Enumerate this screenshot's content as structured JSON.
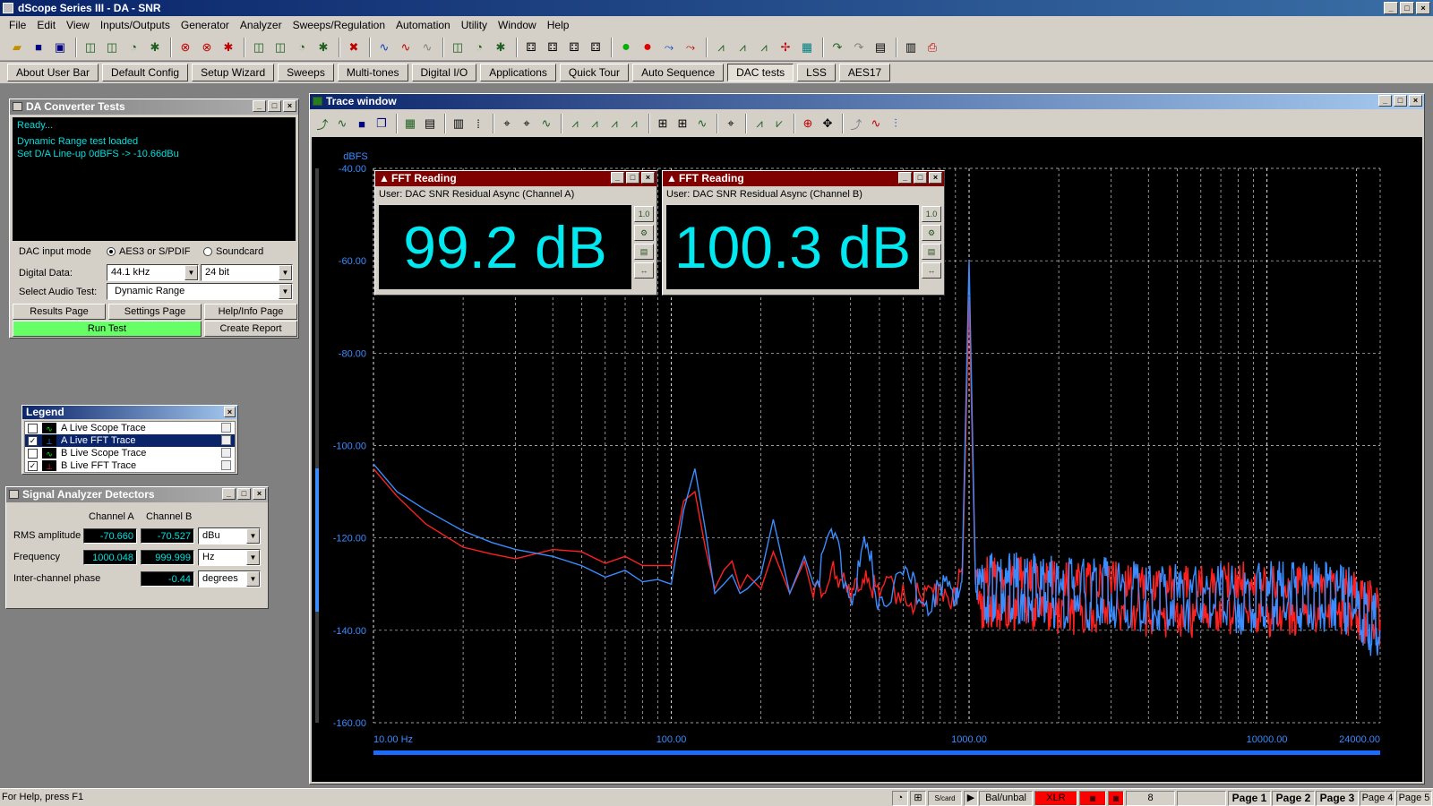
{
  "app": {
    "title": "dScope Series III - DA - SNR"
  },
  "menu": [
    "File",
    "Edit",
    "View",
    "Inputs/Outputs",
    "Generator",
    "Analyzer",
    "Sweeps/Regulation",
    "Automation",
    "Utility",
    "Window",
    "Help"
  ],
  "userbar": [
    "About User Bar",
    "Default Config",
    "Setup Wizard",
    "Sweeps",
    "Multi-tones",
    "Digital I/O",
    "Applications",
    "Quick Tour",
    "Auto Sequence",
    "DAC tests",
    "LSS",
    "AES17"
  ],
  "userbar_active": "DAC tests",
  "da_panel": {
    "title": "DA Converter Tests",
    "console": [
      "Ready...",
      "Dynamic Range test loaded",
      "Set D/A Line-up 0dBFS -> -10.66dBu"
    ],
    "dac_input_mode_label": "DAC input mode",
    "mode_opt1": "AES3 or S/PDIF",
    "mode_opt2": "Soundcard",
    "digital_data_label": "Digital Data:",
    "sample_rate": "44.1 kHz",
    "bit_depth": "24 bit",
    "select_test_label": "Select Audio Test:",
    "selected_test": "Dynamic Range",
    "results_btn": "Results Page",
    "settings_btn": "Settings Page",
    "help_btn": "Help/Info Page",
    "run_btn": "Run Test",
    "report_btn": "Create Report"
  },
  "legend": {
    "title": "Legend",
    "items": [
      {
        "label": "A  Live Scope Trace",
        "checked": false
      },
      {
        "label": "A  Live FFT Trace",
        "checked": true
      },
      {
        "label": "B  Live Scope Trace",
        "checked": false
      },
      {
        "label": "B  Live FFT Trace",
        "checked": true
      }
    ]
  },
  "detectors": {
    "title": "Signal Analyzer Detectors",
    "chA": "Channel A",
    "chB": "Channel B",
    "rms_label": "RMS amplitude",
    "rms_a": "-70.660",
    "rms_b": "-70.527",
    "rms_unit": "dBu",
    "freq_label": "Frequency",
    "freq_a": "1000.048",
    "freq_b": "999.999",
    "freq_unit": "Hz",
    "phase_label": "Inter-channel phase",
    "phase": "-0.44",
    "phase_unit": "degrees"
  },
  "trace_window": {
    "title": "Trace window"
  },
  "fft_a": {
    "title": "FFT Reading",
    "sub": "User: DAC SNR Residual Async (Channel A)",
    "value": "99.2 dB"
  },
  "fft_b": {
    "title": "FFT Reading",
    "sub": "User: DAC SNR Residual Async (Channel B)",
    "value": "100.3 dB"
  },
  "chart_data": {
    "type": "line",
    "ylabel": "dBFS",
    "ylim": [
      -160,
      -40
    ],
    "yticks": [
      "-40.00",
      "-60.00",
      "-80.00",
      "-100.00",
      "-120.00",
      "-140.00",
      "-160.00"
    ],
    "xlim": [
      10,
      24000
    ],
    "xscale": "log",
    "xticks": [
      {
        "v": 10,
        "t": "10.00 Hz"
      },
      {
        "v": 100,
        "t": "100.00"
      },
      {
        "v": 1000,
        "t": "1000.00"
      },
      {
        "v": 10000,
        "t": "10000.00"
      },
      {
        "v": 24000,
        "t": "24000.00"
      }
    ],
    "grid": true,
    "colors": {
      "A": "#3a8cff",
      "B": "#ff2020"
    },
    "series": [
      {
        "channel": "B",
        "x": [
          10,
          12,
          15,
          20,
          25,
          30,
          40,
          50,
          60,
          70,
          80,
          90,
          100,
          110,
          120,
          130,
          140,
          150,
          160,
          170,
          180,
          200,
          220,
          250,
          280,
          300,
          350,
          400,
          450,
          500,
          600,
          700,
          800,
          900,
          950,
          1000,
          1050,
          1100,
          1500,
          2000,
          3000,
          5000,
          8000,
          12000,
          18000,
          24000
        ],
        "y": [
          -105,
          -111,
          -117,
          -122,
          -123.5,
          -124.5,
          -122.5,
          -123,
          -125.5,
          -124,
          -126,
          -126,
          -126,
          -112,
          -110,
          -122,
          -131,
          -127,
          -125,
          -131,
          -128,
          -131,
          -123,
          -132,
          -125,
          -133,
          -125,
          -134,
          -127,
          -133,
          -130,
          -135,
          -130,
          -133,
          -128,
          -68,
          -130,
          -132,
          -132,
          -133,
          -133,
          -134,
          -133,
          -134,
          -133,
          -138
        ]
      },
      {
        "channel": "A",
        "x": [
          10,
          12,
          15,
          20,
          25,
          30,
          40,
          50,
          60,
          70,
          80,
          90,
          100,
          110,
          120,
          130,
          140,
          150,
          160,
          170,
          180,
          200,
          220,
          250,
          280,
          300,
          350,
          400,
          450,
          500,
          600,
          700,
          800,
          900,
          950,
          1000,
          1050,
          1100,
          1500,
          2000,
          3000,
          5000,
          8000,
          12000,
          18000,
          24000
        ],
        "y": [
          -104,
          -110,
          -114,
          -118.5,
          -121,
          -122.5,
          -124,
          -126,
          -128.5,
          -127,
          -129.5,
          -129,
          -130,
          -114,
          -105,
          -118,
          -132,
          -130,
          -128,
          -132,
          -131,
          -128,
          -116,
          -132,
          -124,
          -130,
          -120,
          -133,
          -122,
          -133,
          -128,
          -134,
          -130,
          -133,
          -125,
          -60,
          -129,
          -131,
          -131,
          -132,
          -132,
          -133,
          -133,
          -133,
          -133,
          -140
        ]
      }
    ]
  },
  "status": {
    "help": "For Help, press F1",
    "bal": "Bal/unbal",
    "xlr": "XLR",
    "num": "8",
    "pages": [
      "Page 1",
      "Page 2",
      "Page 3",
      "Page 4",
      "Page 5"
    ]
  }
}
